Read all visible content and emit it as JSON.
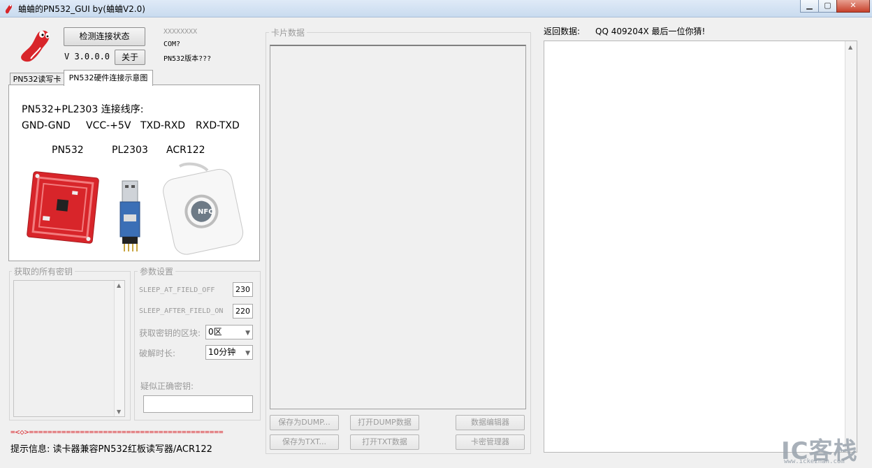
{
  "window": {
    "title": "蛐蛐的PN532_GUI by(蛐蛐V2.0)",
    "minimize": "▁",
    "maximize": "▢",
    "close": "✕"
  },
  "top": {
    "check_btn": "检测连接状态",
    "version": "V 3.0.0.0",
    "about_btn": "关于",
    "serial_placeholder": "XXXXXXXX",
    "com_status": "COM?",
    "pn532_version": "PN532版本???"
  },
  "tabs": {
    "tab1": "PN532读写卡",
    "tab2": "PN532硬件连接示意图"
  },
  "diagram": {
    "heading": "PN532+PL2303  连接线序:",
    "wiring": [
      "GND-GND",
      "VCC-+5V",
      "TXD-RXD",
      "RXD-TXD"
    ],
    "device_labels": [
      "PN532",
      "PL2303",
      "ACR122"
    ],
    "nfc_logo": "NFC"
  },
  "keys_group": {
    "label": "获取的所有密钥"
  },
  "params": {
    "label": "参数设置",
    "sleep_off_label": "SLEEP_AT_FIELD_OFF",
    "sleep_off_value": "230",
    "sleep_on_label": "SLEEP_AFTER_FIELD_ON",
    "sleep_on_value": "220",
    "block_label": "获取密钥的区块:",
    "block_value": "0区",
    "crack_label": "破解时长:",
    "crack_value": "10分钟",
    "suspect_label": "疑似正确密钥:"
  },
  "status": {
    "separator": "=<◇>==========================================",
    "info": "提示信息: 读卡器兼容PN532红板读写器/ACR122"
  },
  "card": {
    "label": "卡片数据",
    "save_dump": "保存为DUMP...",
    "open_dump": "打开DUMP数据",
    "data_editor": "数据编辑器",
    "save_txt": "保存为TXT...",
    "open_txt": "打开TXT数据",
    "key_manager": "卡密管理器"
  },
  "return": {
    "label": "返回数据:",
    "qq": "QQ 409204X 最后一位你猜!"
  },
  "watermark": {
    "brand": "IC客栈",
    "url": "www.ickezhan.com"
  },
  "colors": {
    "pn532_board": "#d8252a",
    "usb_blue": "#3b6fb6",
    "watermark": "#9aa3ad"
  }
}
